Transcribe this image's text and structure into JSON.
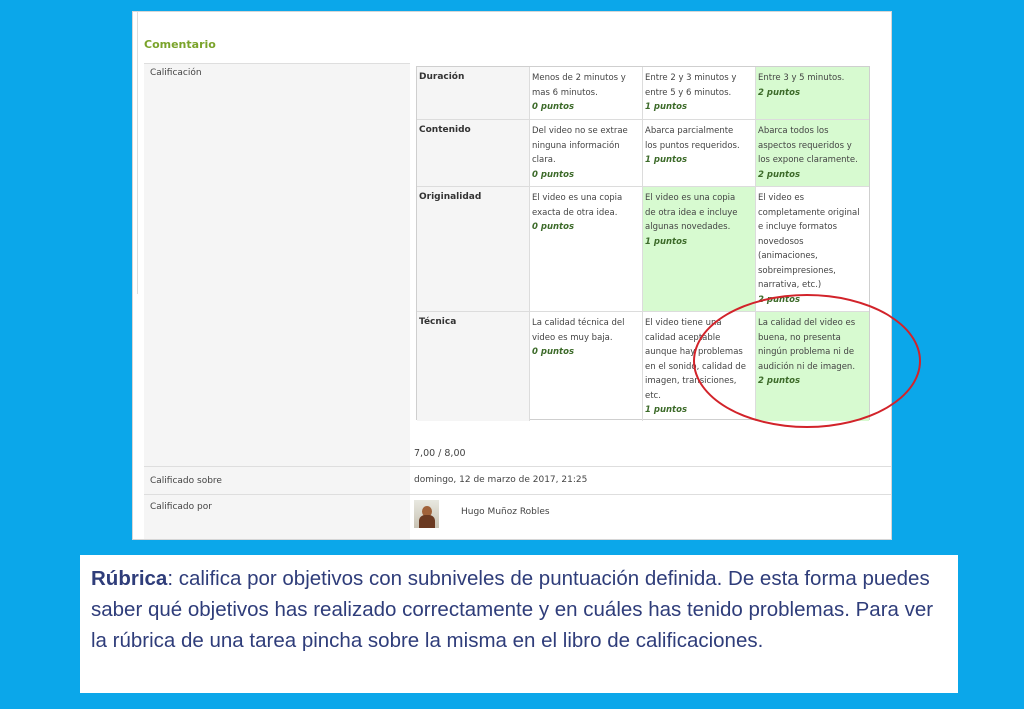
{
  "section_title": "Comentario",
  "labels": {
    "calificacion": "Calificación",
    "calificado_sobre": "Calificado sobre",
    "calificado_por": "Calificado por"
  },
  "rubric": [
    {
      "criterion": "Duración",
      "levels": [
        {
          "description": "Menos de 2 minutos y\nmas 6 minutos.",
          "points": "0 puntos",
          "selected": false
        },
        {
          "description": "Entre 2 y 3 minutos y\nentre 5 y 6 minutos.",
          "points": "1 puntos",
          "selected": false
        },
        {
          "description": "Entre 3 y 5 minutos.",
          "points": "2 puntos",
          "selected": true
        }
      ]
    },
    {
      "criterion": "Contenido",
      "levels": [
        {
          "description": "Del video no se extrae\nninguna información\nclara.",
          "points": "0 puntos",
          "selected": false
        },
        {
          "description": "Abarca parcialmente\nlos puntos requeridos.",
          "points": "1 puntos",
          "selected": false
        },
        {
          "description": "Abarca todos los\naspectos requeridos y\nlos expone claramente.",
          "points": "2 puntos",
          "selected": true
        }
      ]
    },
    {
      "criterion": "Originalidad",
      "levels": [
        {
          "description": "El video es una copia\nexacta de otra idea.",
          "points": "0 puntos",
          "selected": false
        },
        {
          "description": "El video es una copia\nde otra idea e incluye\nalgunas novedades.",
          "points": "1 puntos",
          "selected": true
        },
        {
          "description": "El video es\ncompletamente original\ne incluye formatos\nnovedosos\n(animaciones,\nsobreimpresiones,\nnarrativa, etc.)",
          "points": "2 puntos",
          "selected": false
        }
      ]
    },
    {
      "criterion": "Técnica",
      "levels": [
        {
          "description": "La calidad técnica del\nvideo es muy baja.",
          "points": "0 puntos",
          "selected": false
        },
        {
          "description": "El video tiene una\ncalidad aceptable\naunque hay problemas\nen el sonido, calidad de\nimagen, transiciones,\netc.",
          "points": "1 puntos",
          "selected": false
        },
        {
          "description": "La calidad del video es\nbuena, no presenta\nningún problema ni de\naudición ni de imagen.",
          "points": "2 puntos",
          "selected": true
        }
      ]
    }
  ],
  "score": "7,00 / 8,00",
  "graded_on": "domingo, 12 de marzo de 2017, 21:25",
  "grader": "Hugo Muñoz Robles",
  "caption": {
    "term": "Rúbrica",
    "text": ": califica por objetivos con subniveles de puntuación definida. De esta forma puedes saber qué objetivos has realizado correctamente y en cuáles has tenido problemas. Para ver la rúbrica de una tarea pincha sobre la misma en el libro de calificaciones."
  },
  "colors": {
    "background": "#0ba7ea",
    "selected_level": "#d7fad0",
    "highlight_circle": "#d2232a",
    "section_title": "#7aa32a"
  }
}
